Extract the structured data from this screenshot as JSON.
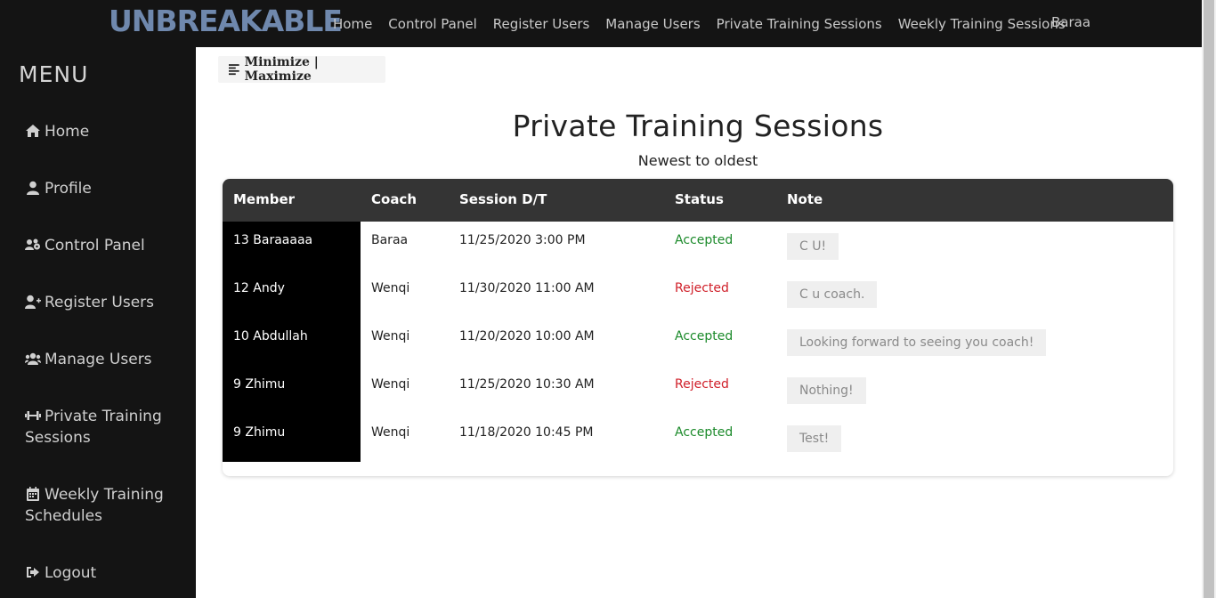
{
  "header": {
    "logo_text": "UNBREAKABLE",
    "nav": [
      "Home",
      "Control Panel",
      "Register Users",
      "Manage Users",
      "Private Training Sessions",
      "Weekly Training Sessions"
    ],
    "user": "Baraa"
  },
  "sidebar": {
    "title": "MENU",
    "items": [
      {
        "label": "Home",
        "icon": "home-icon"
      },
      {
        "label": "Profile",
        "icon": "user-icon"
      },
      {
        "label": "Control Panel",
        "icon": "users-cog-icon"
      },
      {
        "label": "Register Users",
        "icon": "user-plus-icon"
      },
      {
        "label": "Manage Users",
        "icon": "users-icon"
      },
      {
        "label": "Private Training Sessions",
        "icon": "dumbbell-icon"
      },
      {
        "label": "Weekly Training Schedules",
        "icon": "calendar-icon"
      },
      {
        "label": "Logout",
        "icon": "sign-out-icon"
      }
    ]
  },
  "main": {
    "toggle_label": "Minimize | Maximize",
    "title": "Private Training Sessions",
    "subtitle": "Newest to oldest",
    "table": {
      "columns": [
        "Member",
        "Coach",
        "Session D/T",
        "Status",
        "Note"
      ],
      "rows": [
        {
          "member": "13 Baraaaaa",
          "coach": "Baraa",
          "datetime": "11/25/2020 3:00 PM",
          "status": "Accepted",
          "note": "C U!"
        },
        {
          "member": "12 Andy",
          "coach": "Wenqi",
          "datetime": "11/30/2020 11:00 AM",
          "status": "Rejected",
          "note": "C u coach."
        },
        {
          "member": "10 Abdullah",
          "coach": "Wenqi",
          "datetime": "11/20/2020 10:00 AM",
          "status": "Accepted",
          "note": "Looking forward to seeing you coach!"
        },
        {
          "member": "9 Zhimu",
          "coach": "Wenqi",
          "datetime": "11/25/2020 10:30 AM",
          "status": "Rejected",
          "note": "Nothing!"
        },
        {
          "member": "9 Zhimu",
          "coach": "Wenqi",
          "datetime": "11/18/2020 10:45 PM",
          "status": "Accepted",
          "note": "Test!"
        }
      ]
    }
  },
  "colors": {
    "accepted": "#1b8a2a",
    "rejected": "#d0202a",
    "logo": "#6f88ad"
  }
}
